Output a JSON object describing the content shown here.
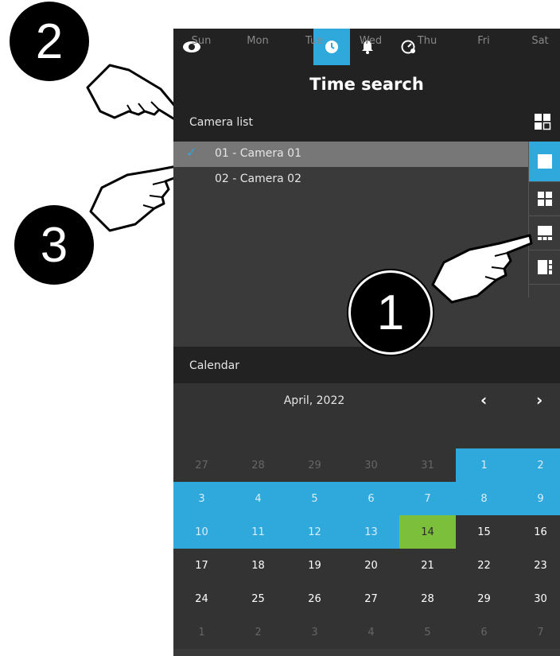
{
  "header": {
    "title": "Time search"
  },
  "camera_list": {
    "label": "Camera list",
    "cameras": [
      {
        "name": "01 - Camera 01",
        "selected": true
      },
      {
        "name": "02 - Camera 02",
        "selected": false
      }
    ]
  },
  "calendar": {
    "label": "Calendar",
    "month": "April, 2022",
    "prev": "‹",
    "next": "›",
    "weekdays": [
      "Sun",
      "Mon",
      "Tue",
      "Wed",
      "Thu",
      "Fri",
      "Sat"
    ],
    "weeks": [
      [
        "27",
        "28",
        "29",
        "30",
        "31",
        "1",
        "2"
      ],
      [
        "3",
        "4",
        "5",
        "6",
        "7",
        "8",
        "9"
      ],
      [
        "10",
        "11",
        "12",
        "13",
        "14",
        "15",
        "16"
      ],
      [
        "17",
        "18",
        "19",
        "20",
        "21",
        "22",
        "23"
      ],
      [
        "24",
        "25",
        "26",
        "27",
        "28",
        "29",
        "30"
      ],
      [
        "1",
        "2",
        "3",
        "4",
        "5",
        "6",
        "7"
      ]
    ],
    "highlighted_range": "1 - 13",
    "today": "14"
  },
  "callouts": {
    "step1": "1",
    "step2": "2",
    "step3": "3"
  },
  "colors": {
    "accent": "#2fa8dc",
    "today": "#7bbf3a",
    "bar": "#222222",
    "panel": "#3a3a3a"
  }
}
